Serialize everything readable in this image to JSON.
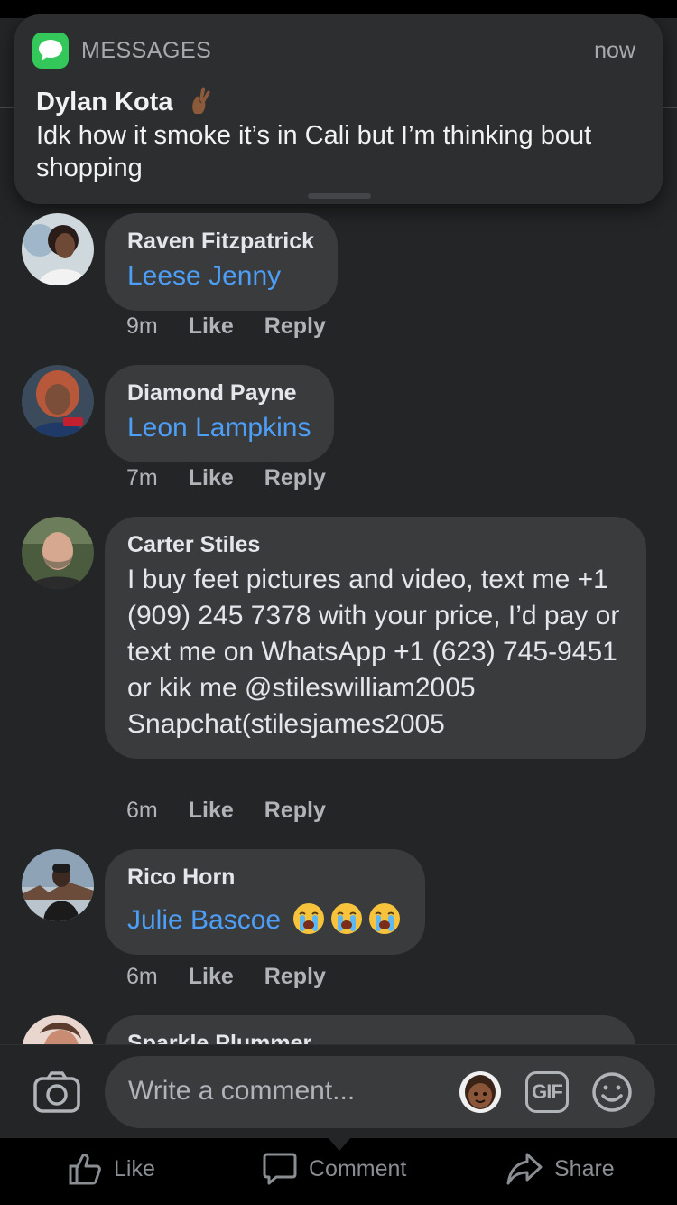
{
  "notification": {
    "app": "MESSAGES",
    "time": "now",
    "sender": "Dylan Kota",
    "sender_emoji": "crossed-fingers-emoji",
    "body": "Idk how it smoke it’s in Cali but I’m thinking bout shopping"
  },
  "comments": [
    {
      "author": "Raven Fitzpatrick",
      "mention": "Leese Jenny",
      "time": "9m",
      "like": "Like",
      "reply": "Reply"
    },
    {
      "author": "Diamond Payne",
      "mention": "Leon Lampkins",
      "time": "7m",
      "like": "Like",
      "reply": "Reply"
    },
    {
      "author": "Carter Stiles",
      "text": "I buy feet pictures and video, text me +1 (909) 245 7378 with your price, I’d pay or text me on WhatsApp  +1 (623) 745-9451 or kik me @stileswilliam2005 Snapchat(stilesjames2005",
      "time": "6m",
      "like": "Like",
      "reply": "Reply"
    },
    {
      "author": "Rico Horn",
      "mention": "Julie Bascoe",
      "emoji": "loudly-crying-face-emoji",
      "time": "6m",
      "like": "Like",
      "reply": "Reply"
    },
    {
      "author": "Sparkle Plummer"
    }
  ],
  "composer": {
    "placeholder": "Write a comment...",
    "gif_label": "GIF"
  },
  "action_bar": {
    "like": "Like",
    "comment": "Comment",
    "share": "Share"
  },
  "colors": {
    "background": "#242526",
    "bubble": "#3a3b3c",
    "mention": "#4d9ef6",
    "messages_green": "#34c759"
  }
}
